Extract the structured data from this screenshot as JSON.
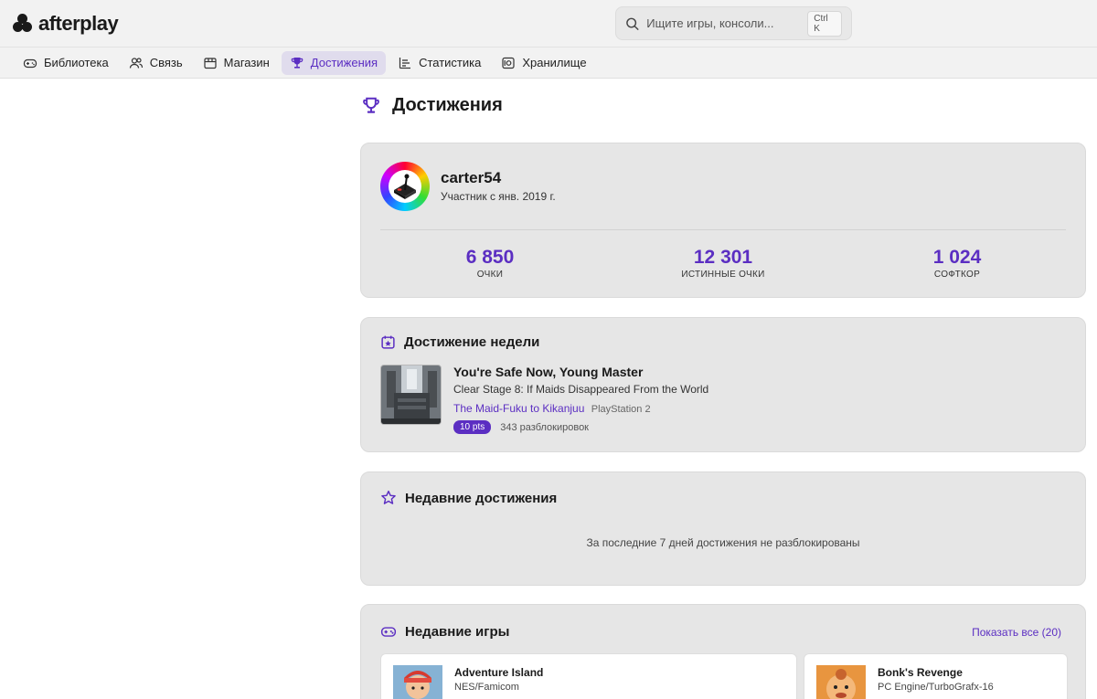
{
  "app": {
    "name": "afterplay"
  },
  "search": {
    "placeholder": "Ищите игры, консоли...",
    "shortcut": "Ctrl K"
  },
  "nav": {
    "items": [
      {
        "label": "Библиотека",
        "icon": "gamepad-icon",
        "active": false
      },
      {
        "label": "Связь",
        "icon": "users-icon",
        "active": false
      },
      {
        "label": "Магазин",
        "icon": "store-icon",
        "active": false
      },
      {
        "label": "Достижения",
        "icon": "trophy-icon",
        "active": true
      },
      {
        "label": "Статистика",
        "icon": "bar-chart-icon",
        "active": false
      },
      {
        "label": "Хранилище",
        "icon": "storage-icon",
        "active": false
      }
    ]
  },
  "page": {
    "title": "Достижения",
    "title_icon": "trophy-icon"
  },
  "profile": {
    "username": "carter54",
    "member_since": "Участник с янв. 2019 г.",
    "stats": [
      {
        "value": "6 850",
        "label": "ОЧКИ"
      },
      {
        "value": "12 301",
        "label": "ИСТИННЫЕ ОЧКИ"
      },
      {
        "value": "1 024",
        "label": "СОФТКОР"
      }
    ]
  },
  "weekly": {
    "heading": "Достижение недели",
    "icon": "calendar-star-icon",
    "title": "You're Safe Now, Young Master",
    "description": "Clear Stage 8: If Maids Disappeared From the World",
    "game": "The Maid-Fuku to Kikanjuu",
    "platform": "PlayStation 2",
    "points": "10 pts",
    "unlocks": "343 разблокировок"
  },
  "recent_achievements": {
    "heading": "Недавние достижения",
    "icon": "star-icon",
    "empty_message": "За последние 7 дней достижения не разблокированы"
  },
  "recent_games": {
    "heading": "Недавние игры",
    "icon": "gamepad-icon",
    "show_all": "Показать все (20)",
    "items": [
      {
        "name": "Adventure Island",
        "platform": "NES/Famicom"
      },
      {
        "name": "Bonk's Revenge",
        "platform": "PC Engine/TurboGrafx-16"
      }
    ]
  },
  "colors": {
    "accent": "#5b2ec2",
    "card_bg": "#e6e6e6",
    "header_bg": "#f2f2f2"
  }
}
